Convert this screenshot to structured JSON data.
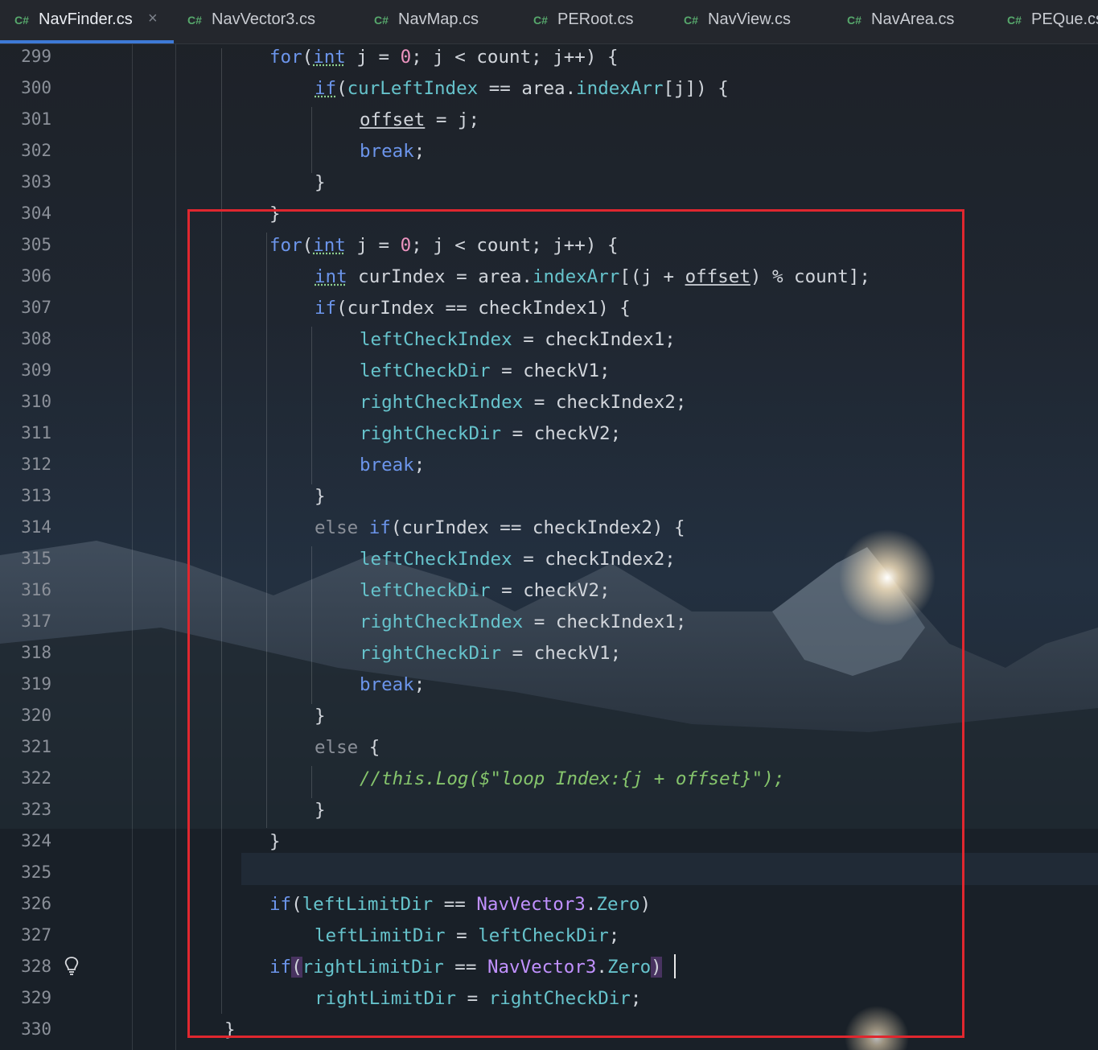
{
  "tabs": [
    {
      "lang": "C#",
      "name": "NavFinder.cs",
      "active": true,
      "closable": true,
      "close_icon": "×"
    },
    {
      "lang": "C#",
      "name": "NavVector3.cs"
    },
    {
      "lang": "C#",
      "name": "NavMap.cs"
    },
    {
      "lang": "C#",
      "name": "PERoot.cs"
    },
    {
      "lang": "C#",
      "name": "NavView.cs"
    },
    {
      "lang": "C#",
      "name": "NavArea.cs"
    },
    {
      "lang": "C#",
      "name": "PEQue.cs"
    }
  ],
  "line_numbers": [
    "299",
    "300",
    "301",
    "302",
    "303",
    "304",
    "305",
    "306",
    "307",
    "308",
    "309",
    "310",
    "311",
    "312",
    "313",
    "314",
    "315",
    "316",
    "317",
    "318",
    "319",
    "320",
    "321",
    "322",
    "323",
    "324",
    "325",
    "326",
    "327",
    "328",
    "329",
    "330"
  ],
  "gutter_icon": "lightbulb-icon",
  "code": {
    "l299": {
      "for": "for",
      "int": "int",
      "a": " j = ",
      "zero": "0",
      "b": "; j < count; j++) {"
    },
    "l300": {
      "if": "if",
      "a": "(",
      "f1": "curLeftIndex",
      "b": " == area.",
      "f2": "indexArr",
      "c": "[j]) {"
    },
    "l301": {
      "a": "offset",
      "b": " = j;"
    },
    "l302": {
      "brk": "break",
      "b": ";"
    },
    "l303": {
      "a": "}"
    },
    "l304": {
      "a": "}"
    },
    "l305": {
      "for": "for",
      "int": "int",
      "a": " j = ",
      "zero": "0",
      "b": "; j < count; j++) {"
    },
    "l306": {
      "int": "int",
      "a": " curIndex = area.",
      "f": "indexArr",
      "b": "[(j + ",
      "off": "offset",
      "c": ") % count];"
    },
    "l307": {
      "if": "if",
      "a": "(curIndex == checkIndex1) {"
    },
    "l308": {
      "f": "leftCheckIndex",
      "a": " = checkIndex1;"
    },
    "l309": {
      "f": "leftCheckDir",
      "a": " = checkV1;"
    },
    "l310": {
      "f": "rightCheckIndex",
      "a": " = checkIndex2;"
    },
    "l311": {
      "f": "rightCheckDir",
      "a": " = checkV2;"
    },
    "l312": {
      "brk": "break",
      "b": ";"
    },
    "l313": {
      "a": "}"
    },
    "l314": {
      "else": "else",
      "if": "if",
      "a": "(curIndex == checkIndex2) {"
    },
    "l315": {
      "f": "leftCheckIndex",
      "a": " = checkIndex2;"
    },
    "l316": {
      "f": "leftCheckDir",
      "a": " = checkV2;"
    },
    "l317": {
      "f": "rightCheckIndex",
      "a": " = checkIndex1;"
    },
    "l318": {
      "f": "rightCheckDir",
      "a": " = checkV1;"
    },
    "l319": {
      "brk": "break",
      "b": ";"
    },
    "l320": {
      "a": "}"
    },
    "l321": {
      "else": "else",
      "a": " {"
    },
    "l322": {
      "cmt": "//this.Log($\"loop Index:{j + offset}\");"
    },
    "l323": {
      "a": "}"
    },
    "l324": {
      "a": "}"
    },
    "l326": {
      "if": "if",
      "a": "(",
      "f": "leftLimitDir",
      "b": " == ",
      "t": "NavVector3",
      "c": ".",
      "z": "Zero",
      "d": ")"
    },
    "l327": {
      "f1": "leftLimitDir",
      "a": " = ",
      "f2": "leftCheckDir",
      "b": ";"
    },
    "l328": {
      "if": "if",
      "p1": "(",
      "f": "rightLimitDir",
      "b": " == ",
      "t": "NavVector3",
      "c": ".",
      "z": "Zero",
      "p2": ")"
    },
    "l329": {
      "f1": "rightLimitDir",
      "a": " = ",
      "f2": "rightCheckDir",
      "b": ";"
    },
    "l330": {
      "a": "}"
    }
  },
  "colors": {
    "keyword": "#6c95eb",
    "number": "#ed94c0",
    "field": "#66c3cc",
    "type": "#c191ff",
    "comment": "#85c46c",
    "highlight_box": "#e0272f",
    "tab_underline": "#3d7ad6"
  }
}
